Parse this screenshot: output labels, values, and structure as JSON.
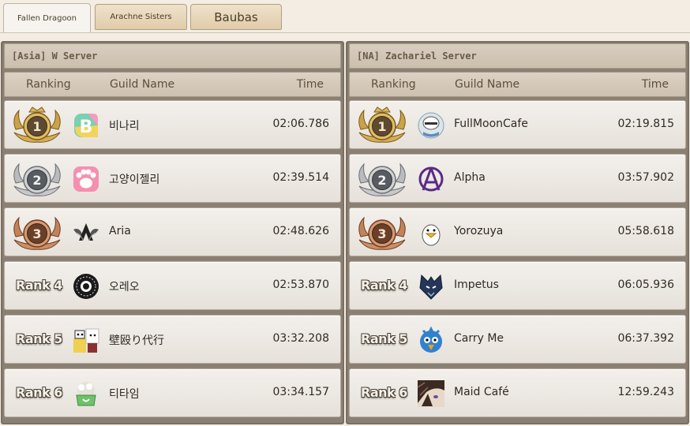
{
  "tabs": [
    {
      "label": "Fallen Dragoon"
    },
    {
      "label": "Arachne Sisters"
    },
    {
      "label": "Baubas"
    }
  ],
  "headers": {
    "ranking": "Ranking",
    "guild": "Guild Name",
    "time": "Time"
  },
  "left": {
    "server": "[Asia] W Server",
    "rows": [
      {
        "rank": "1",
        "name": "비나리",
        "time": "02:06.786"
      },
      {
        "rank": "2",
        "name": "고양이젤리",
        "time": "02:39.514"
      },
      {
        "rank": "3",
        "name": "Aria",
        "time": "02:48.626"
      },
      {
        "rank": "Rank 4",
        "name": "오레오",
        "time": "02:53.870"
      },
      {
        "rank": "Rank 5",
        "name": "壁殴り代行",
        "time": "03:32.208"
      },
      {
        "rank": "Rank 6",
        "name": "티타임",
        "time": "03:34.157"
      }
    ]
  },
  "right": {
    "server": "[NA] Zachariel Server",
    "rows": [
      {
        "rank": "1",
        "name": "FullMoonCafe",
        "time": "02:19.815"
      },
      {
        "rank": "2",
        "name": "Alpha",
        "time": "03:57.902"
      },
      {
        "rank": "3",
        "name": "Yorozuya",
        "time": "05:58.618"
      },
      {
        "rank": "Rank 4",
        "name": "Impetus",
        "time": "06:05.936"
      },
      {
        "rank": "Rank 5",
        "name": "Carry Me",
        "time": "06:37.392"
      },
      {
        "rank": "Rank 6",
        "name": "Maid Café",
        "time": "12:59.243"
      }
    ]
  }
}
